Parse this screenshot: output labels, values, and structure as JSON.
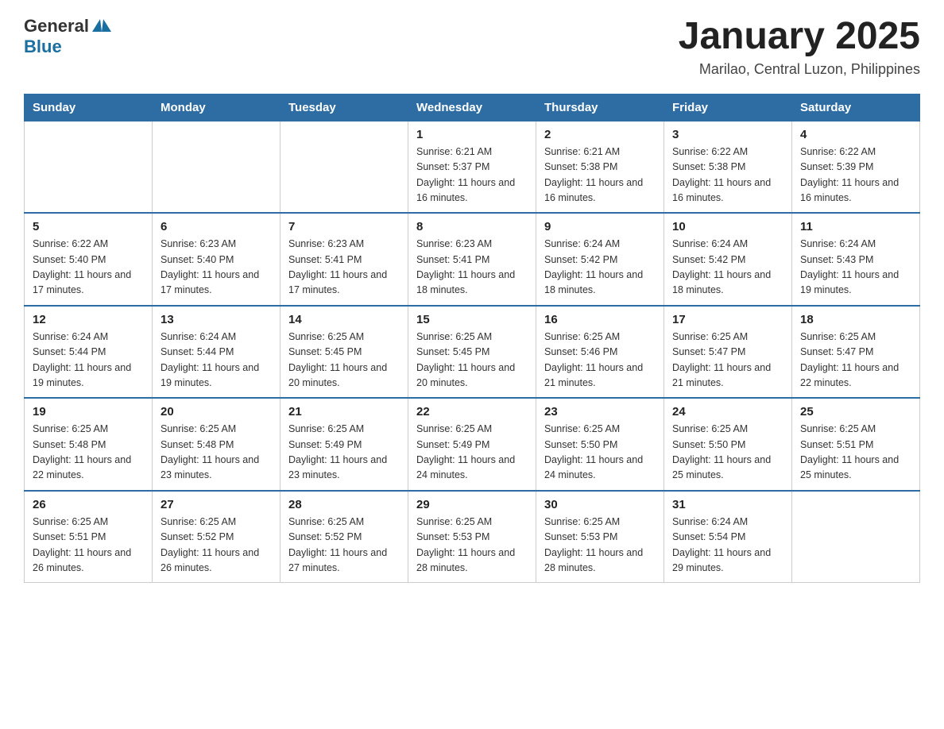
{
  "header": {
    "logo_general": "General",
    "logo_blue": "Blue",
    "month_title": "January 2025",
    "location": "Marilao, Central Luzon, Philippines"
  },
  "weekdays": [
    "Sunday",
    "Monday",
    "Tuesday",
    "Wednesday",
    "Thursday",
    "Friday",
    "Saturday"
  ],
  "weeks": [
    [
      {
        "day": "",
        "info": ""
      },
      {
        "day": "",
        "info": ""
      },
      {
        "day": "",
        "info": ""
      },
      {
        "day": "1",
        "info": "Sunrise: 6:21 AM\nSunset: 5:37 PM\nDaylight: 11 hours and 16 minutes."
      },
      {
        "day": "2",
        "info": "Sunrise: 6:21 AM\nSunset: 5:38 PM\nDaylight: 11 hours and 16 minutes."
      },
      {
        "day": "3",
        "info": "Sunrise: 6:22 AM\nSunset: 5:38 PM\nDaylight: 11 hours and 16 minutes."
      },
      {
        "day": "4",
        "info": "Sunrise: 6:22 AM\nSunset: 5:39 PM\nDaylight: 11 hours and 16 minutes."
      }
    ],
    [
      {
        "day": "5",
        "info": "Sunrise: 6:22 AM\nSunset: 5:40 PM\nDaylight: 11 hours and 17 minutes."
      },
      {
        "day": "6",
        "info": "Sunrise: 6:23 AM\nSunset: 5:40 PM\nDaylight: 11 hours and 17 minutes."
      },
      {
        "day": "7",
        "info": "Sunrise: 6:23 AM\nSunset: 5:41 PM\nDaylight: 11 hours and 17 minutes."
      },
      {
        "day": "8",
        "info": "Sunrise: 6:23 AM\nSunset: 5:41 PM\nDaylight: 11 hours and 18 minutes."
      },
      {
        "day": "9",
        "info": "Sunrise: 6:24 AM\nSunset: 5:42 PM\nDaylight: 11 hours and 18 minutes."
      },
      {
        "day": "10",
        "info": "Sunrise: 6:24 AM\nSunset: 5:42 PM\nDaylight: 11 hours and 18 minutes."
      },
      {
        "day": "11",
        "info": "Sunrise: 6:24 AM\nSunset: 5:43 PM\nDaylight: 11 hours and 19 minutes."
      }
    ],
    [
      {
        "day": "12",
        "info": "Sunrise: 6:24 AM\nSunset: 5:44 PM\nDaylight: 11 hours and 19 minutes."
      },
      {
        "day": "13",
        "info": "Sunrise: 6:24 AM\nSunset: 5:44 PM\nDaylight: 11 hours and 19 minutes."
      },
      {
        "day": "14",
        "info": "Sunrise: 6:25 AM\nSunset: 5:45 PM\nDaylight: 11 hours and 20 minutes."
      },
      {
        "day": "15",
        "info": "Sunrise: 6:25 AM\nSunset: 5:45 PM\nDaylight: 11 hours and 20 minutes."
      },
      {
        "day": "16",
        "info": "Sunrise: 6:25 AM\nSunset: 5:46 PM\nDaylight: 11 hours and 21 minutes."
      },
      {
        "day": "17",
        "info": "Sunrise: 6:25 AM\nSunset: 5:47 PM\nDaylight: 11 hours and 21 minutes."
      },
      {
        "day": "18",
        "info": "Sunrise: 6:25 AM\nSunset: 5:47 PM\nDaylight: 11 hours and 22 minutes."
      }
    ],
    [
      {
        "day": "19",
        "info": "Sunrise: 6:25 AM\nSunset: 5:48 PM\nDaylight: 11 hours and 22 minutes."
      },
      {
        "day": "20",
        "info": "Sunrise: 6:25 AM\nSunset: 5:48 PM\nDaylight: 11 hours and 23 minutes."
      },
      {
        "day": "21",
        "info": "Sunrise: 6:25 AM\nSunset: 5:49 PM\nDaylight: 11 hours and 23 minutes."
      },
      {
        "day": "22",
        "info": "Sunrise: 6:25 AM\nSunset: 5:49 PM\nDaylight: 11 hours and 24 minutes."
      },
      {
        "day": "23",
        "info": "Sunrise: 6:25 AM\nSunset: 5:50 PM\nDaylight: 11 hours and 24 minutes."
      },
      {
        "day": "24",
        "info": "Sunrise: 6:25 AM\nSunset: 5:50 PM\nDaylight: 11 hours and 25 minutes."
      },
      {
        "day": "25",
        "info": "Sunrise: 6:25 AM\nSunset: 5:51 PM\nDaylight: 11 hours and 25 minutes."
      }
    ],
    [
      {
        "day": "26",
        "info": "Sunrise: 6:25 AM\nSunset: 5:51 PM\nDaylight: 11 hours and 26 minutes."
      },
      {
        "day": "27",
        "info": "Sunrise: 6:25 AM\nSunset: 5:52 PM\nDaylight: 11 hours and 26 minutes."
      },
      {
        "day": "28",
        "info": "Sunrise: 6:25 AM\nSunset: 5:52 PM\nDaylight: 11 hours and 27 minutes."
      },
      {
        "day": "29",
        "info": "Sunrise: 6:25 AM\nSunset: 5:53 PM\nDaylight: 11 hours and 28 minutes."
      },
      {
        "day": "30",
        "info": "Sunrise: 6:25 AM\nSunset: 5:53 PM\nDaylight: 11 hours and 28 minutes."
      },
      {
        "day": "31",
        "info": "Sunrise: 6:24 AM\nSunset: 5:54 PM\nDaylight: 11 hours and 29 minutes."
      },
      {
        "day": "",
        "info": ""
      }
    ]
  ]
}
